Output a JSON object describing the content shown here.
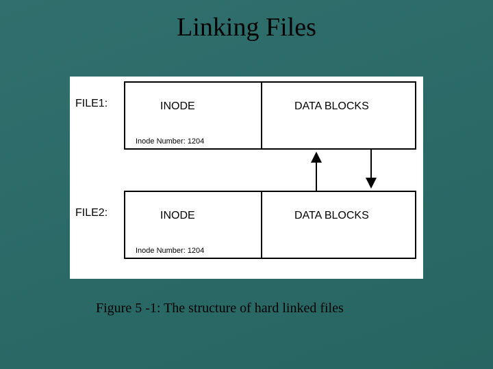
{
  "title": "Linking Files",
  "caption": "Figure 5 -1: The structure of hard linked files",
  "file1": {
    "label": "FILE1:",
    "inode_label": "INODE",
    "data_label": "DATA BLOCKS",
    "inode_number_label": "Inode Number: 1204"
  },
  "file2": {
    "label": "FILE2:",
    "inode_label": "INODE",
    "data_label": "DATA BLOCKS",
    "inode_number_label": "Inode Number: 1204"
  }
}
